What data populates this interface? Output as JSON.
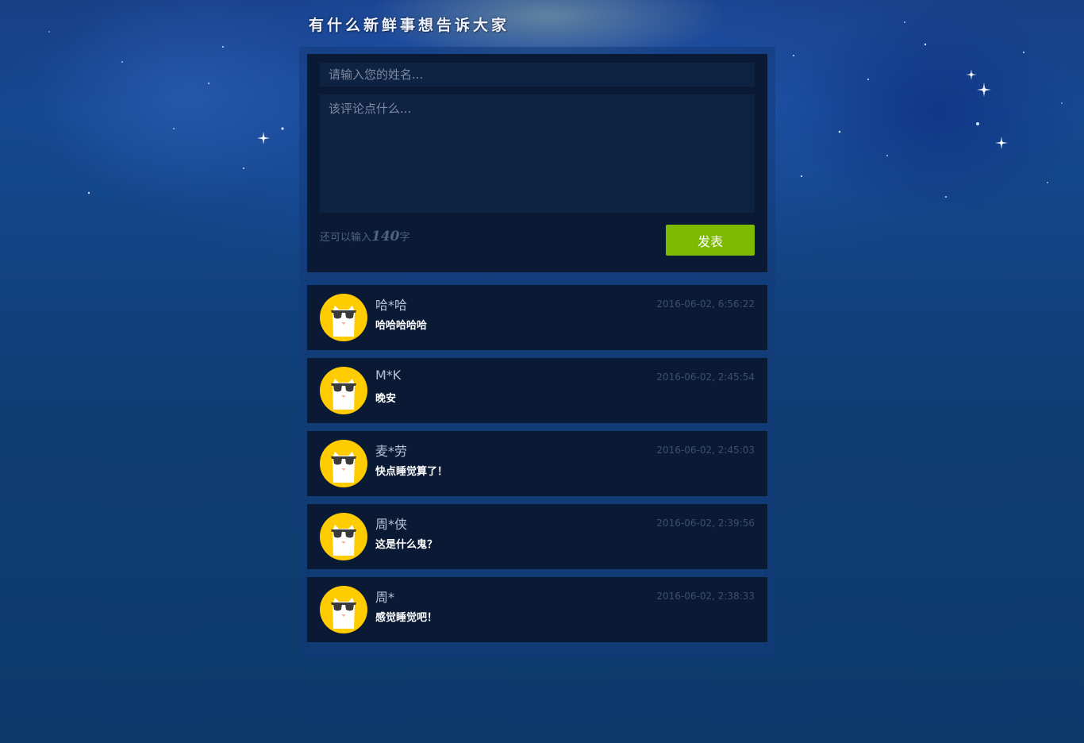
{
  "header": {
    "title": "有什么新鲜事想告诉大家"
  },
  "compose": {
    "name_placeholder": "请输入您的姓名...",
    "comment_placeholder": "该评论点什么...",
    "counter_prefix": "还可以输入",
    "counter_value": "140",
    "counter_suffix": "字",
    "post_label": "发表",
    "post_color": "#7dba00"
  },
  "comments": [
    {
      "author": "哈*哈",
      "text": "哈哈哈哈哈",
      "time": "2016-06-02, 6:56:22",
      "avatar_icon": "sunglasses-cat-avatar"
    },
    {
      "author": "M*K",
      "text": "晚安",
      "time": "2016-06-02, 2:45:54",
      "avatar_icon": "sunglasses-cat-avatar"
    },
    {
      "author": "麦*劳",
      "text": "快点睡觉算了！",
      "time": "2016-06-02, 2:45:03",
      "avatar_icon": "sunglasses-cat-avatar"
    },
    {
      "author": "周*侠",
      "text": "这是什么鬼？",
      "time": "2016-06-02, 2:39:56",
      "avatar_icon": "sunglasses-cat-avatar"
    },
    {
      "author": "周*",
      "text": "感觉睡觉吧！",
      "time": "2016-06-02, 2:38:33",
      "avatar_icon": "sunglasses-cat-avatar"
    }
  ],
  "colors": {
    "panel_bg": "#0a1a35",
    "input_bg": "#0e2242",
    "avatar_bg": "#ffcc00"
  }
}
